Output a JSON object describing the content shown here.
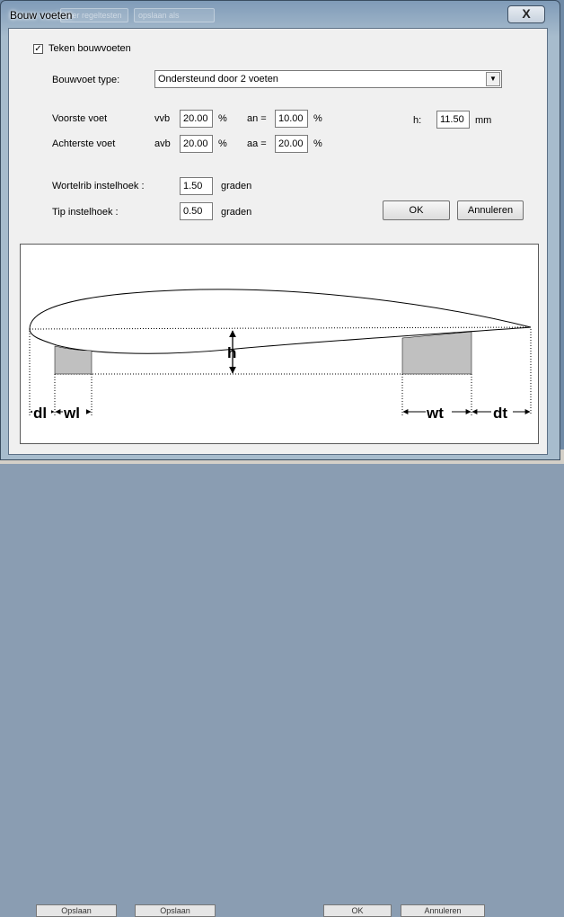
{
  "window": {
    "title": "Bouw voeten",
    "close_symbol": "X"
  },
  "background_ghosts": [
    "ijker regeltesten",
    "opslaan als"
  ],
  "background_buttons": [
    "Opslaan",
    "Opslaan",
    "OK",
    "Annuleren"
  ],
  "form": {
    "draw_checkbox": {
      "label": "Teken bouwvoeten",
      "checked": true,
      "check_symbol": "✓"
    },
    "type": {
      "label": "Bouwvoet type:",
      "value": "Ondersteund door 2 voeten",
      "arrow": "▼"
    },
    "front_foot": {
      "label": "Voorste voet",
      "width_label": "vvb",
      "width_value": "20.00",
      "width_unit": "%",
      "angle_label": "an =",
      "angle_value": "10.00",
      "angle_unit": "%"
    },
    "rear_foot": {
      "label": "Achterste voet",
      "width_label": "avb",
      "width_value": "20.00",
      "width_unit": "%",
      "angle_label": "aa =",
      "angle_value": "20.00",
      "angle_unit": "%"
    },
    "height": {
      "label": "h:",
      "value": "11.50",
      "unit": "mm"
    },
    "root_angle": {
      "label": "Wortelrib instelhoek :",
      "value": "1.50",
      "unit": "graden"
    },
    "tip_angle": {
      "label": "Tip instelhoek :",
      "value": "0.50",
      "unit": "graden"
    },
    "ok_label": "OK",
    "cancel_label": "Annuleren"
  },
  "diagram": {
    "labels": {
      "h": "h",
      "dl": "dl",
      "wl": "wl",
      "wt": "wt",
      "dt": "dt"
    },
    "fill_color": "#c0c0c0"
  }
}
